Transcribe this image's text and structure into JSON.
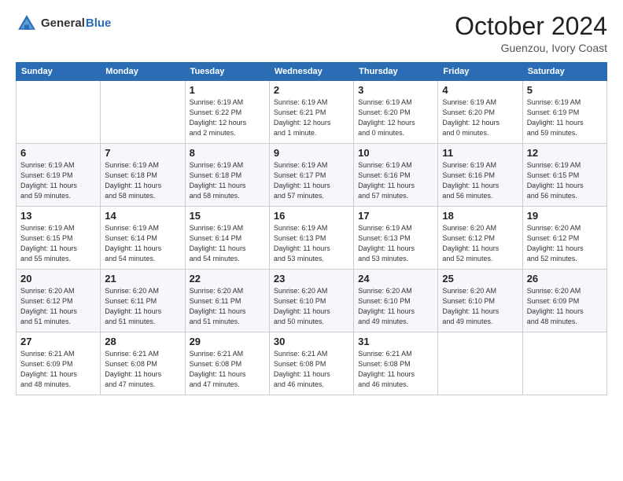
{
  "header": {
    "logo_general": "General",
    "logo_blue": "Blue",
    "month_title": "October 2024",
    "location": "Guenzou, Ivory Coast"
  },
  "days_of_week": [
    "Sunday",
    "Monday",
    "Tuesday",
    "Wednesday",
    "Thursday",
    "Friday",
    "Saturday"
  ],
  "weeks": [
    [
      {
        "day": "",
        "detail": ""
      },
      {
        "day": "",
        "detail": ""
      },
      {
        "day": "1",
        "detail": "Sunrise: 6:19 AM\nSunset: 6:22 PM\nDaylight: 12 hours\nand 2 minutes."
      },
      {
        "day": "2",
        "detail": "Sunrise: 6:19 AM\nSunset: 6:21 PM\nDaylight: 12 hours\nand 1 minute."
      },
      {
        "day": "3",
        "detail": "Sunrise: 6:19 AM\nSunset: 6:20 PM\nDaylight: 12 hours\nand 0 minutes."
      },
      {
        "day": "4",
        "detail": "Sunrise: 6:19 AM\nSunset: 6:20 PM\nDaylight: 12 hours\nand 0 minutes."
      },
      {
        "day": "5",
        "detail": "Sunrise: 6:19 AM\nSunset: 6:19 PM\nDaylight: 11 hours\nand 59 minutes."
      }
    ],
    [
      {
        "day": "6",
        "detail": "Sunrise: 6:19 AM\nSunset: 6:19 PM\nDaylight: 11 hours\nand 59 minutes."
      },
      {
        "day": "7",
        "detail": "Sunrise: 6:19 AM\nSunset: 6:18 PM\nDaylight: 11 hours\nand 58 minutes."
      },
      {
        "day": "8",
        "detail": "Sunrise: 6:19 AM\nSunset: 6:18 PM\nDaylight: 11 hours\nand 58 minutes."
      },
      {
        "day": "9",
        "detail": "Sunrise: 6:19 AM\nSunset: 6:17 PM\nDaylight: 11 hours\nand 57 minutes."
      },
      {
        "day": "10",
        "detail": "Sunrise: 6:19 AM\nSunset: 6:16 PM\nDaylight: 11 hours\nand 57 minutes."
      },
      {
        "day": "11",
        "detail": "Sunrise: 6:19 AM\nSunset: 6:16 PM\nDaylight: 11 hours\nand 56 minutes."
      },
      {
        "day": "12",
        "detail": "Sunrise: 6:19 AM\nSunset: 6:15 PM\nDaylight: 11 hours\nand 56 minutes."
      }
    ],
    [
      {
        "day": "13",
        "detail": "Sunrise: 6:19 AM\nSunset: 6:15 PM\nDaylight: 11 hours\nand 55 minutes."
      },
      {
        "day": "14",
        "detail": "Sunrise: 6:19 AM\nSunset: 6:14 PM\nDaylight: 11 hours\nand 54 minutes."
      },
      {
        "day": "15",
        "detail": "Sunrise: 6:19 AM\nSunset: 6:14 PM\nDaylight: 11 hours\nand 54 minutes."
      },
      {
        "day": "16",
        "detail": "Sunrise: 6:19 AM\nSunset: 6:13 PM\nDaylight: 11 hours\nand 53 minutes."
      },
      {
        "day": "17",
        "detail": "Sunrise: 6:19 AM\nSunset: 6:13 PM\nDaylight: 11 hours\nand 53 minutes."
      },
      {
        "day": "18",
        "detail": "Sunrise: 6:20 AM\nSunset: 6:12 PM\nDaylight: 11 hours\nand 52 minutes."
      },
      {
        "day": "19",
        "detail": "Sunrise: 6:20 AM\nSunset: 6:12 PM\nDaylight: 11 hours\nand 52 minutes."
      }
    ],
    [
      {
        "day": "20",
        "detail": "Sunrise: 6:20 AM\nSunset: 6:12 PM\nDaylight: 11 hours\nand 51 minutes."
      },
      {
        "day": "21",
        "detail": "Sunrise: 6:20 AM\nSunset: 6:11 PM\nDaylight: 11 hours\nand 51 minutes."
      },
      {
        "day": "22",
        "detail": "Sunrise: 6:20 AM\nSunset: 6:11 PM\nDaylight: 11 hours\nand 51 minutes."
      },
      {
        "day": "23",
        "detail": "Sunrise: 6:20 AM\nSunset: 6:10 PM\nDaylight: 11 hours\nand 50 minutes."
      },
      {
        "day": "24",
        "detail": "Sunrise: 6:20 AM\nSunset: 6:10 PM\nDaylight: 11 hours\nand 49 minutes."
      },
      {
        "day": "25",
        "detail": "Sunrise: 6:20 AM\nSunset: 6:10 PM\nDaylight: 11 hours\nand 49 minutes."
      },
      {
        "day": "26",
        "detail": "Sunrise: 6:20 AM\nSunset: 6:09 PM\nDaylight: 11 hours\nand 48 minutes."
      }
    ],
    [
      {
        "day": "27",
        "detail": "Sunrise: 6:21 AM\nSunset: 6:09 PM\nDaylight: 11 hours\nand 48 minutes."
      },
      {
        "day": "28",
        "detail": "Sunrise: 6:21 AM\nSunset: 6:08 PM\nDaylight: 11 hours\nand 47 minutes."
      },
      {
        "day": "29",
        "detail": "Sunrise: 6:21 AM\nSunset: 6:08 PM\nDaylight: 11 hours\nand 47 minutes."
      },
      {
        "day": "30",
        "detail": "Sunrise: 6:21 AM\nSunset: 6:08 PM\nDaylight: 11 hours\nand 46 minutes."
      },
      {
        "day": "31",
        "detail": "Sunrise: 6:21 AM\nSunset: 6:08 PM\nDaylight: 11 hours\nand 46 minutes."
      },
      {
        "day": "",
        "detail": ""
      },
      {
        "day": "",
        "detail": ""
      }
    ]
  ]
}
